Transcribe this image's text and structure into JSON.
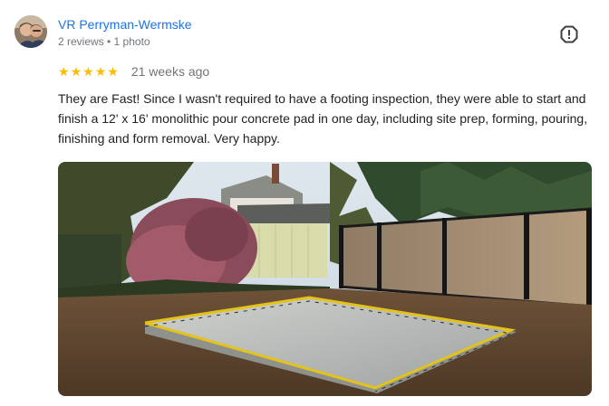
{
  "review": {
    "reviewer_name": "VR Perryman-Wermske",
    "reviewer_meta": "2 reviews • 1 photo",
    "rating": 5,
    "stars": [
      "★",
      "★",
      "★",
      "★",
      "★"
    ],
    "time_ago": "21 weeks ago",
    "text": "They are Fast! Since I wasn't required to have a footing inspection, they were able to start and finish a 12' x 16' monolithic pour concrete pad in one day, including site prep, forming, pouring, finishing and form removal. Very happy.",
    "photo_count": 1
  },
  "icons": {
    "report": "report-exclamation-icon",
    "star": "star-icon"
  },
  "colors": {
    "name_link": "#1a73e8",
    "meta_text": "#70757a",
    "star": "#fbbc04",
    "body_text": "#202124"
  }
}
